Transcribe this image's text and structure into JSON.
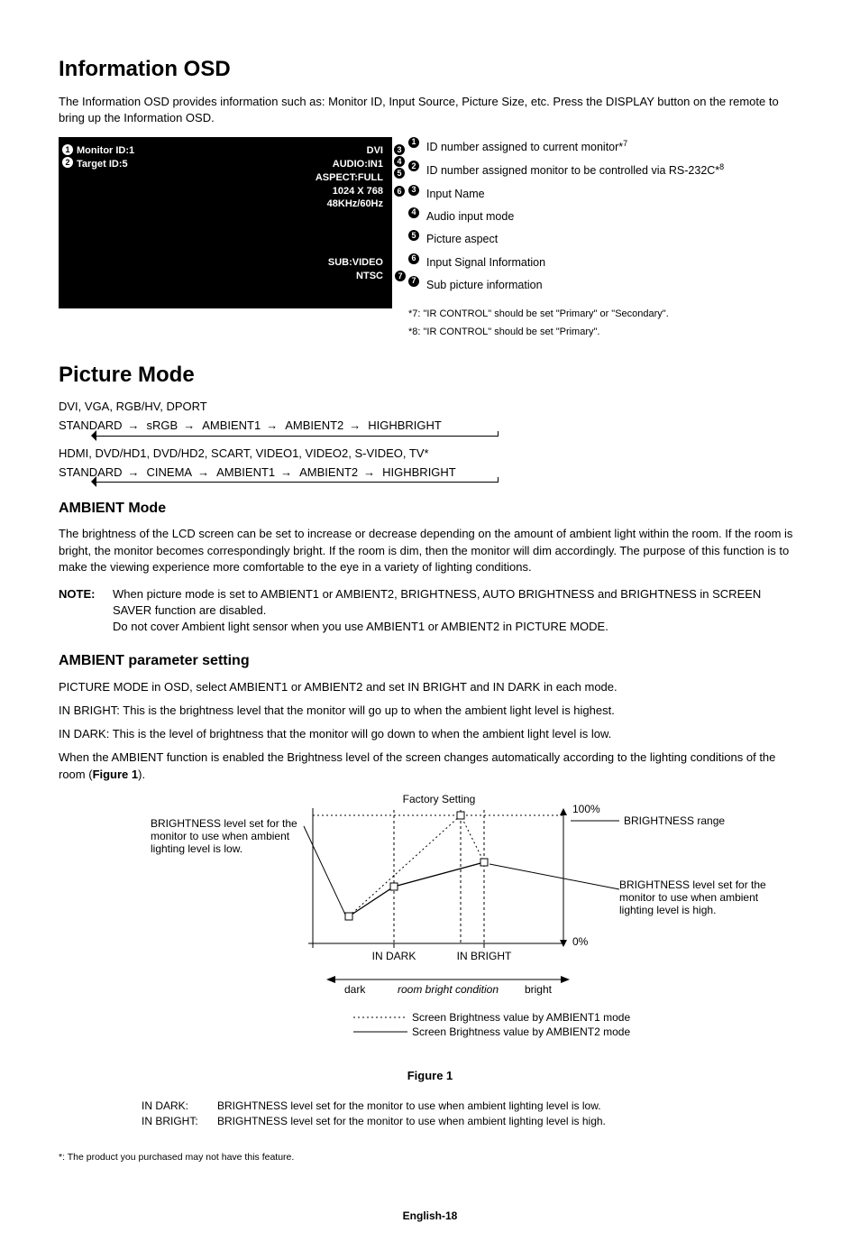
{
  "h_info_osd": "Information OSD",
  "info_intro": "The Information OSD provides information such as: Monitor ID, Input Source, Picture Size, etc. Press the DISPLAY button on the remote to bring up the Information OSD.",
  "osd": {
    "monitor_id": "Monitor ID:1",
    "target_id": "Target ID:5",
    "r1": "DVI",
    "r2": "AUDIO:IN1",
    "r3": "ASPECT:FULL",
    "r4": "1024 X 768",
    "r5": "48KHz/60Hz",
    "sub1": "SUB:VIDEO",
    "sub2": "NTSC"
  },
  "legend": {
    "i1": "ID number assigned to current monitor*",
    "i1s": "7",
    "i2": "ID number assigned monitor to be controlled via RS-232C*",
    "i2s": "8",
    "i3": "Input Name",
    "i4": "Audio input mode",
    "i5": "Picture aspect",
    "i6": "Input Signal Information",
    "i7": "Sub picture information",
    "fn7": "*7: \"IR CONTROL\" should be set \"Primary\" or \"Secondary\".",
    "fn8": "*8: \"IR CONTROL\" should be set \"Primary\"."
  },
  "h_picmode": "Picture Mode",
  "pm_inputs1": "DVI, VGA, RGB/HV, DPORT",
  "pm_s": {
    "a": "STANDARD",
    "b": "sRGB",
    "c": "AMBIENT1",
    "d": "AMBIENT2",
    "e": "HIGHBRIGHT"
  },
  "pm_inputs2": "HDMI, DVD/HD1, DVD/HD2, SCART, VIDEO1, VIDEO2, S-VIDEO, TV*",
  "pm_s2": {
    "a": "STANDARD",
    "b": "CINEMA",
    "c": "AMBIENT1",
    "d": "AMBIENT2",
    "e": "HIGHBRIGHT"
  },
  "h_ambient": "AMBIENT Mode",
  "ambient_body": "The brightness of the LCD screen can be set to increase or decrease depending on the amount of ambient light within the room. If the room is bright, the monitor becomes correspondingly bright. If the room is dim, then the monitor will dim accordingly. The purpose of this function is to make the viewing experience more comfortable to the eye in a variety of lighting conditions.",
  "note_label": "NOTE:",
  "note_body1": "When picture mode is set to AMBIENT1 or AMBIENT2, BRIGHTNESS, AUTO BRIGHTNESS and BRIGHTNESS in SCREEN SAVER function are disabled.",
  "note_body2": "Do not cover Ambient light sensor when you use AMBIENT1 or AMBIENT2 in PICTURE MODE.",
  "h_param": "AMBIENT parameter setting",
  "param_p1": "PICTURE MODE in OSD, select AMBIENT1 or AMBIENT2 and set IN BRIGHT and IN DARK in each mode.",
  "param_p2": "IN BRIGHT: This is the brightness level that the monitor will go up to when the ambient light level is highest.",
  "param_p3": "IN DARK: This is the level of brightness that the monitor will go down to when the ambient light level is low.",
  "param_p4a": "When the AMBIENT function is enabled the Brightness level of the screen changes automatically according to the lighting conditions of the room (",
  "param_p4b": "Figure 1",
  "param_p4c": ").",
  "fig": {
    "factory": "Factory Setting",
    "p100": "100%",
    "p0": "0%",
    "indark": "IN DARK",
    "inbright": "IN BRIGHT",
    "dark": "dark",
    "bright": "bright",
    "room": "room bright condition",
    "bl_left": "BRIGHTNESS level set for the monitor to use when ambient lighting level is low.",
    "br_range": "BRIGHTNESS range",
    "bl_right": "BRIGHTNESS level set for the monitor to use when ambient lighting level is high.",
    "leg1": "Screen Brightness value by AMBIENT1 mode",
    "leg2": "Screen Brightness value by AMBIENT2 mode",
    "caption": "Figure 1"
  },
  "defs": {
    "darklab": "IN DARK:",
    "darkval": "BRIGHTNESS level set for the monitor to use when ambient lighting level is low.",
    "brightlab": "IN BRIGHT:",
    "brightval": "BRIGHTNESS level set for the monitor to use when ambient lighting level is high."
  },
  "footstar": "*: The product you purchased may not have this feature.",
  "pgnum": "English-18",
  "chart_data": {
    "type": "line",
    "title": "Figure 1",
    "xlabel": "room bright condition",
    "ylabel": "BRIGHTNESS",
    "x_categories": [
      "dark",
      "IN DARK",
      "IN BRIGHT",
      "bright"
    ],
    "ylim": [
      0,
      100
    ],
    "annotations": [
      "Factory Setting",
      "BRIGHTNESS range",
      "100%",
      "0%"
    ],
    "series": [
      {
        "name": "Screen Brightness value by AMBIENT1 mode",
        "style": "dotted",
        "points": [
          {
            "x": "IN DARK (low)",
            "y_pct": 20
          },
          {
            "x": "Factory Setting",
            "y_pct": 95
          },
          {
            "x": "IN BRIGHT",
            "y_pct": 60
          }
        ]
      },
      {
        "name": "Screen Brightness value by AMBIENT2 mode",
        "style": "solid",
        "points": [
          {
            "x": "IN DARK (low)",
            "y_pct": 20
          },
          {
            "x": "IN DARK",
            "y_pct": 42
          },
          {
            "x": "IN BRIGHT",
            "y_pct": 60
          }
        ]
      }
    ]
  }
}
